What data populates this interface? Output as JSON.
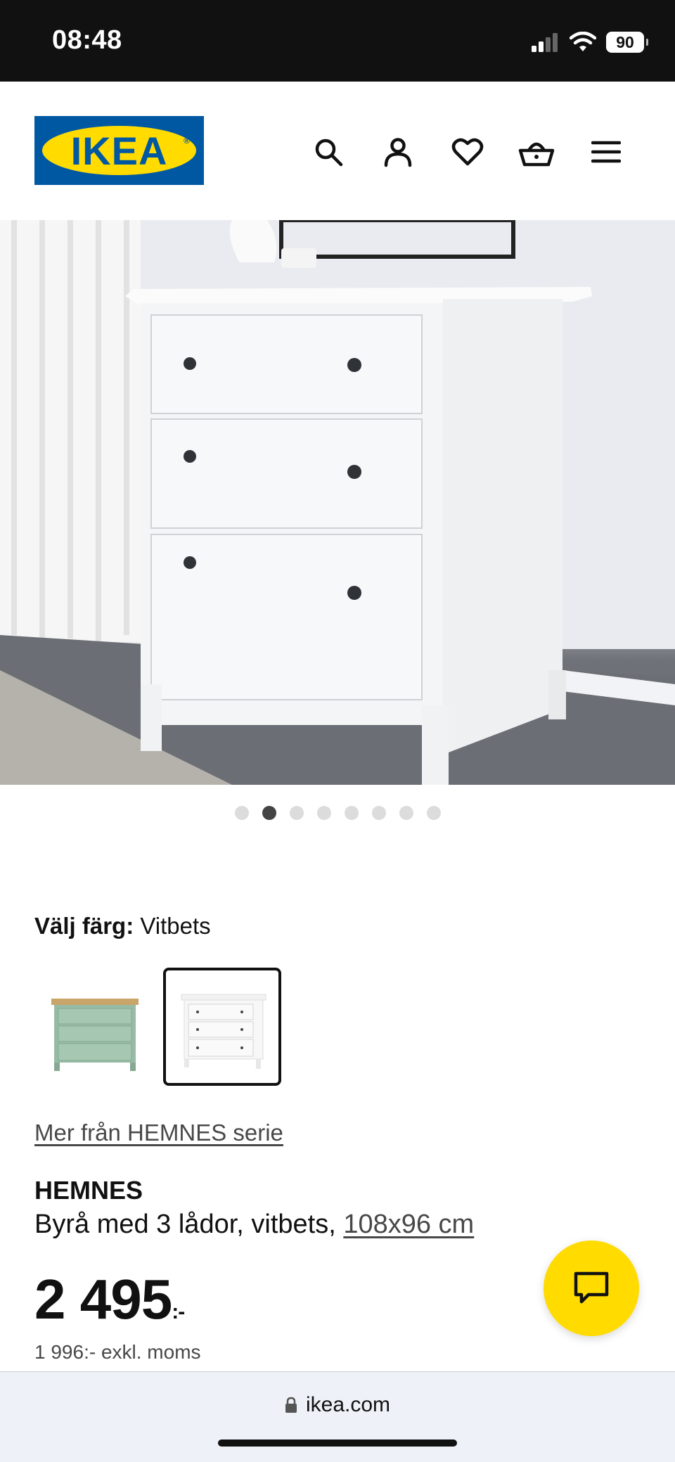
{
  "status_bar": {
    "time": "08:48",
    "battery": "90"
  },
  "header": {
    "logo_text": "IKEA"
  },
  "gallery": {
    "slide_count": 8,
    "active_index": 1
  },
  "product": {
    "color_label": "Välj färg:",
    "color_value": "Vitbets",
    "series_link": "Mer från HEMNES serie",
    "name": "HEMNES",
    "description": "Byrå med 3 lådor, vitbets,",
    "size": "108x96 cm",
    "price": "2 495",
    "price_suffix": ":-",
    "price_excl": "1 996:- exkl. moms"
  },
  "browser": {
    "url": "ikea.com"
  },
  "colors": {
    "ikea_blue": "#0058a3",
    "ikea_yellow": "#ffdb00"
  }
}
